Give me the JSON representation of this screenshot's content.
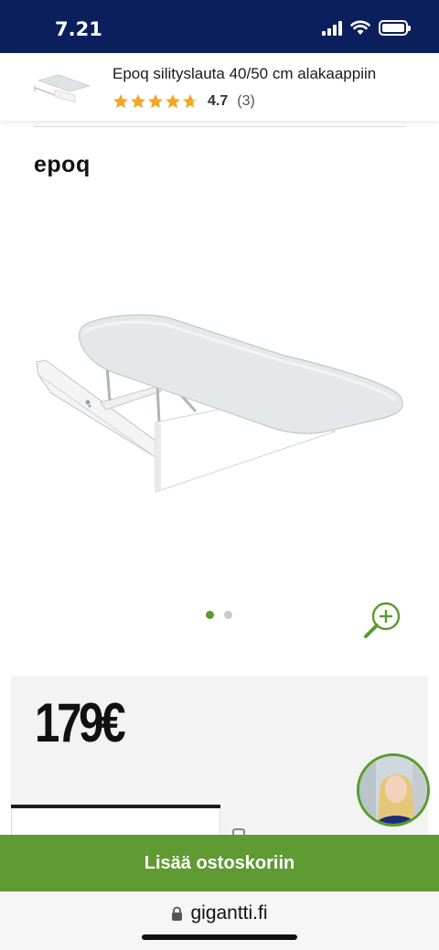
{
  "status_bar": {
    "time": "7.21"
  },
  "product_header": {
    "title": "Epoq silityslauta 40/50 cm alakaappiin",
    "rating": {
      "score": "4.7",
      "count": "(3)",
      "stars_value": 4.7,
      "star_color": "#f5a623"
    }
  },
  "brand": {
    "name": "epoq"
  },
  "carousel": {
    "image_count": 2,
    "active_index": 0,
    "accent": "#5a9b2e"
  },
  "price": {
    "value": "179€"
  },
  "cta": {
    "label": "Lisää ostoskoriin",
    "color": "#5f9a33"
  },
  "browser": {
    "url": "gigantti.fi"
  },
  "colors": {
    "status_bar_bg": "#0b1f5c",
    "accent_green": "#5a9b2e"
  }
}
